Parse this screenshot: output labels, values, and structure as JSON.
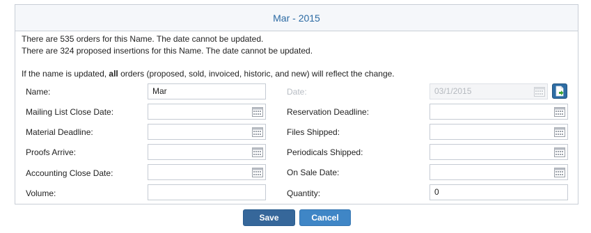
{
  "panel": {
    "title": "Mar - 2015"
  },
  "messages": [
    "There are 535 orders for this Name. The date cannot be updated.",
    "There are 324 proposed insertions for this Name. The date cannot be updated."
  ],
  "info": {
    "prefix": "If the name is updated, ",
    "bold": "all",
    "suffix": " orders (proposed, sold, invoiced, historic, and new) will reflect the change."
  },
  "form": {
    "left": [
      {
        "label": "Name:",
        "value": "Mar"
      },
      {
        "label": "Mailing List Close Date:",
        "value": ""
      },
      {
        "label": "Material Deadline:",
        "value": ""
      },
      {
        "label": "Proofs Arrive:",
        "value": ""
      },
      {
        "label": "Accounting Close Date:",
        "value": ""
      },
      {
        "label": "Volume:",
        "value": ""
      }
    ],
    "right": [
      {
        "label": "Date:",
        "value": "03/1/2015"
      },
      {
        "label": "Reservation Deadline:",
        "value": ""
      },
      {
        "label": "Files Shipped:",
        "value": ""
      },
      {
        "label": "Periodicals Shipped:",
        "value": ""
      },
      {
        "label": "On Sale Date:",
        "value": ""
      },
      {
        "label": "Quantity:",
        "value": "0"
      }
    ]
  },
  "buttons": {
    "save": "Save",
    "cancel": "Cancel"
  },
  "icons": {
    "calendar": "calendar-icon",
    "export": "export-document-icon"
  },
  "colors": {
    "title": "#2b6aa3",
    "save": "#36679a",
    "cancel": "#3f86c6"
  }
}
